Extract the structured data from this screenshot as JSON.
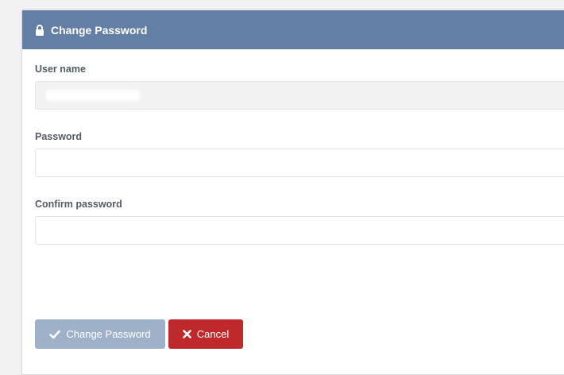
{
  "dialog": {
    "title": "Change Password",
    "title_icon": "lock-icon"
  },
  "form": {
    "username": {
      "label": "User name",
      "value": ""
    },
    "password": {
      "label": "Password",
      "placeholder": ""
    },
    "confirm": {
      "label": "Confirm password",
      "placeholder": ""
    }
  },
  "buttons": {
    "submit_label": "Change Password",
    "submit_icon": "check-icon",
    "cancel_label": "Cancel",
    "cancel_icon": "close-icon"
  },
  "colors": {
    "header": "#647fa6",
    "submit_disabled": "#9fb0c9",
    "cancel": "#c0292b"
  }
}
